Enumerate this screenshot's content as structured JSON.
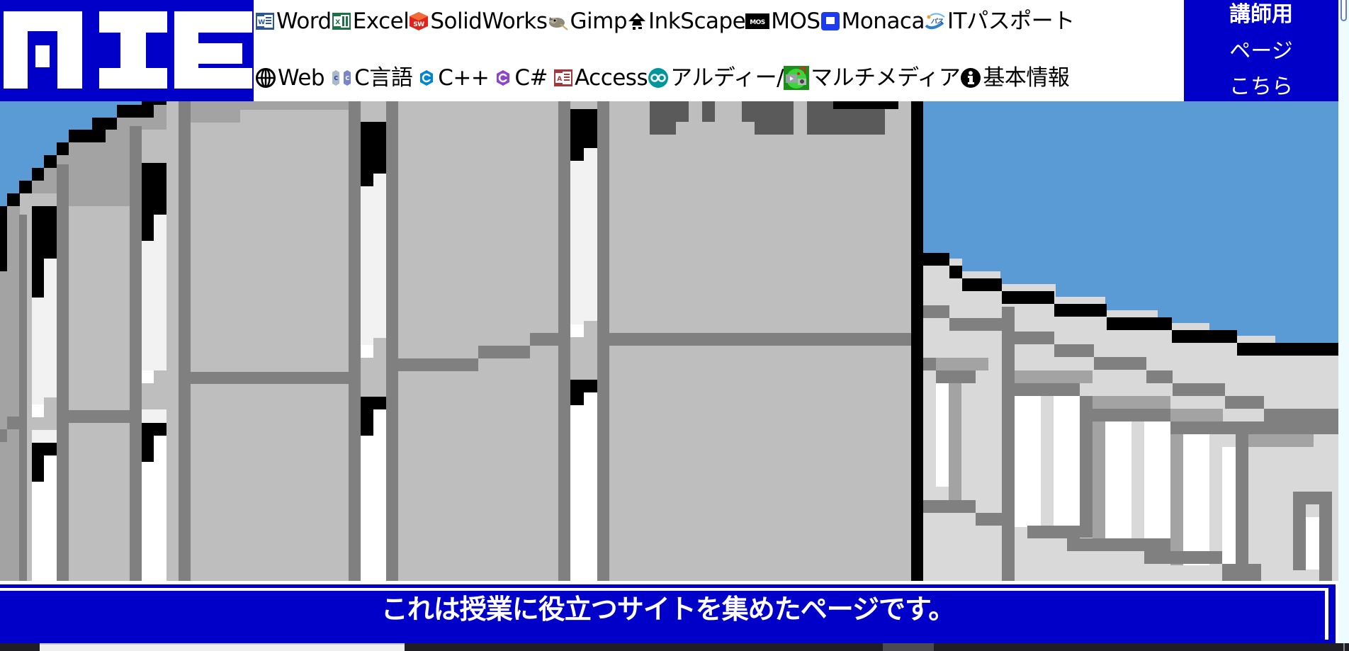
{
  "logo": {
    "text": "MIE",
    "color_bg": "#0000c8",
    "color_fg": "#ffffff"
  },
  "nav": {
    "row1": [
      {
        "label": "Word",
        "icon": "word-icon"
      },
      {
        "label": "Excel",
        "icon": "excel-icon"
      },
      {
        "label": "SolidWorks",
        "icon": "solidworks-icon"
      },
      {
        "label": "Gimp",
        "icon": "gimp-icon"
      },
      {
        "label": "InkScape",
        "icon": "inkscape-icon"
      },
      {
        "label": "MOS",
        "icon": "mos-icon",
        "icon_text": "MOS"
      },
      {
        "label": "Monaca",
        "icon": "monaca-icon"
      },
      {
        "label": "ITパスポート",
        "icon": "it-passport-icon",
        "icon_text": "パス"
      }
    ],
    "row2": [
      {
        "label": "Web",
        "icon": "globe-icon"
      },
      {
        "label": "C言語",
        "icon": "c-language-icon"
      },
      {
        "label": "C++",
        "icon": "cpp-icon"
      },
      {
        "label": "C#",
        "icon": "csharp-icon"
      },
      {
        "label": "Access",
        "icon": "access-icon"
      },
      {
        "label": "アルディー/",
        "icon": "arduino-icon"
      },
      {
        "label": "マルチメディア",
        "icon": "multimedia-icon"
      },
      {
        "label": "基本情報",
        "icon": "info-icon"
      }
    ]
  },
  "teacher_link": {
    "line1": "講師用",
    "line2": "ページ",
    "line3": "こちら"
  },
  "banner": {
    "text": "これは授業に役立つサイトを集めたページです。"
  },
  "colors": {
    "brand_blue": "#0000c8",
    "sky_blue": "#5b9bd5",
    "scrollbar_track": "#eefcff",
    "taskbar": "#1f1e24"
  }
}
